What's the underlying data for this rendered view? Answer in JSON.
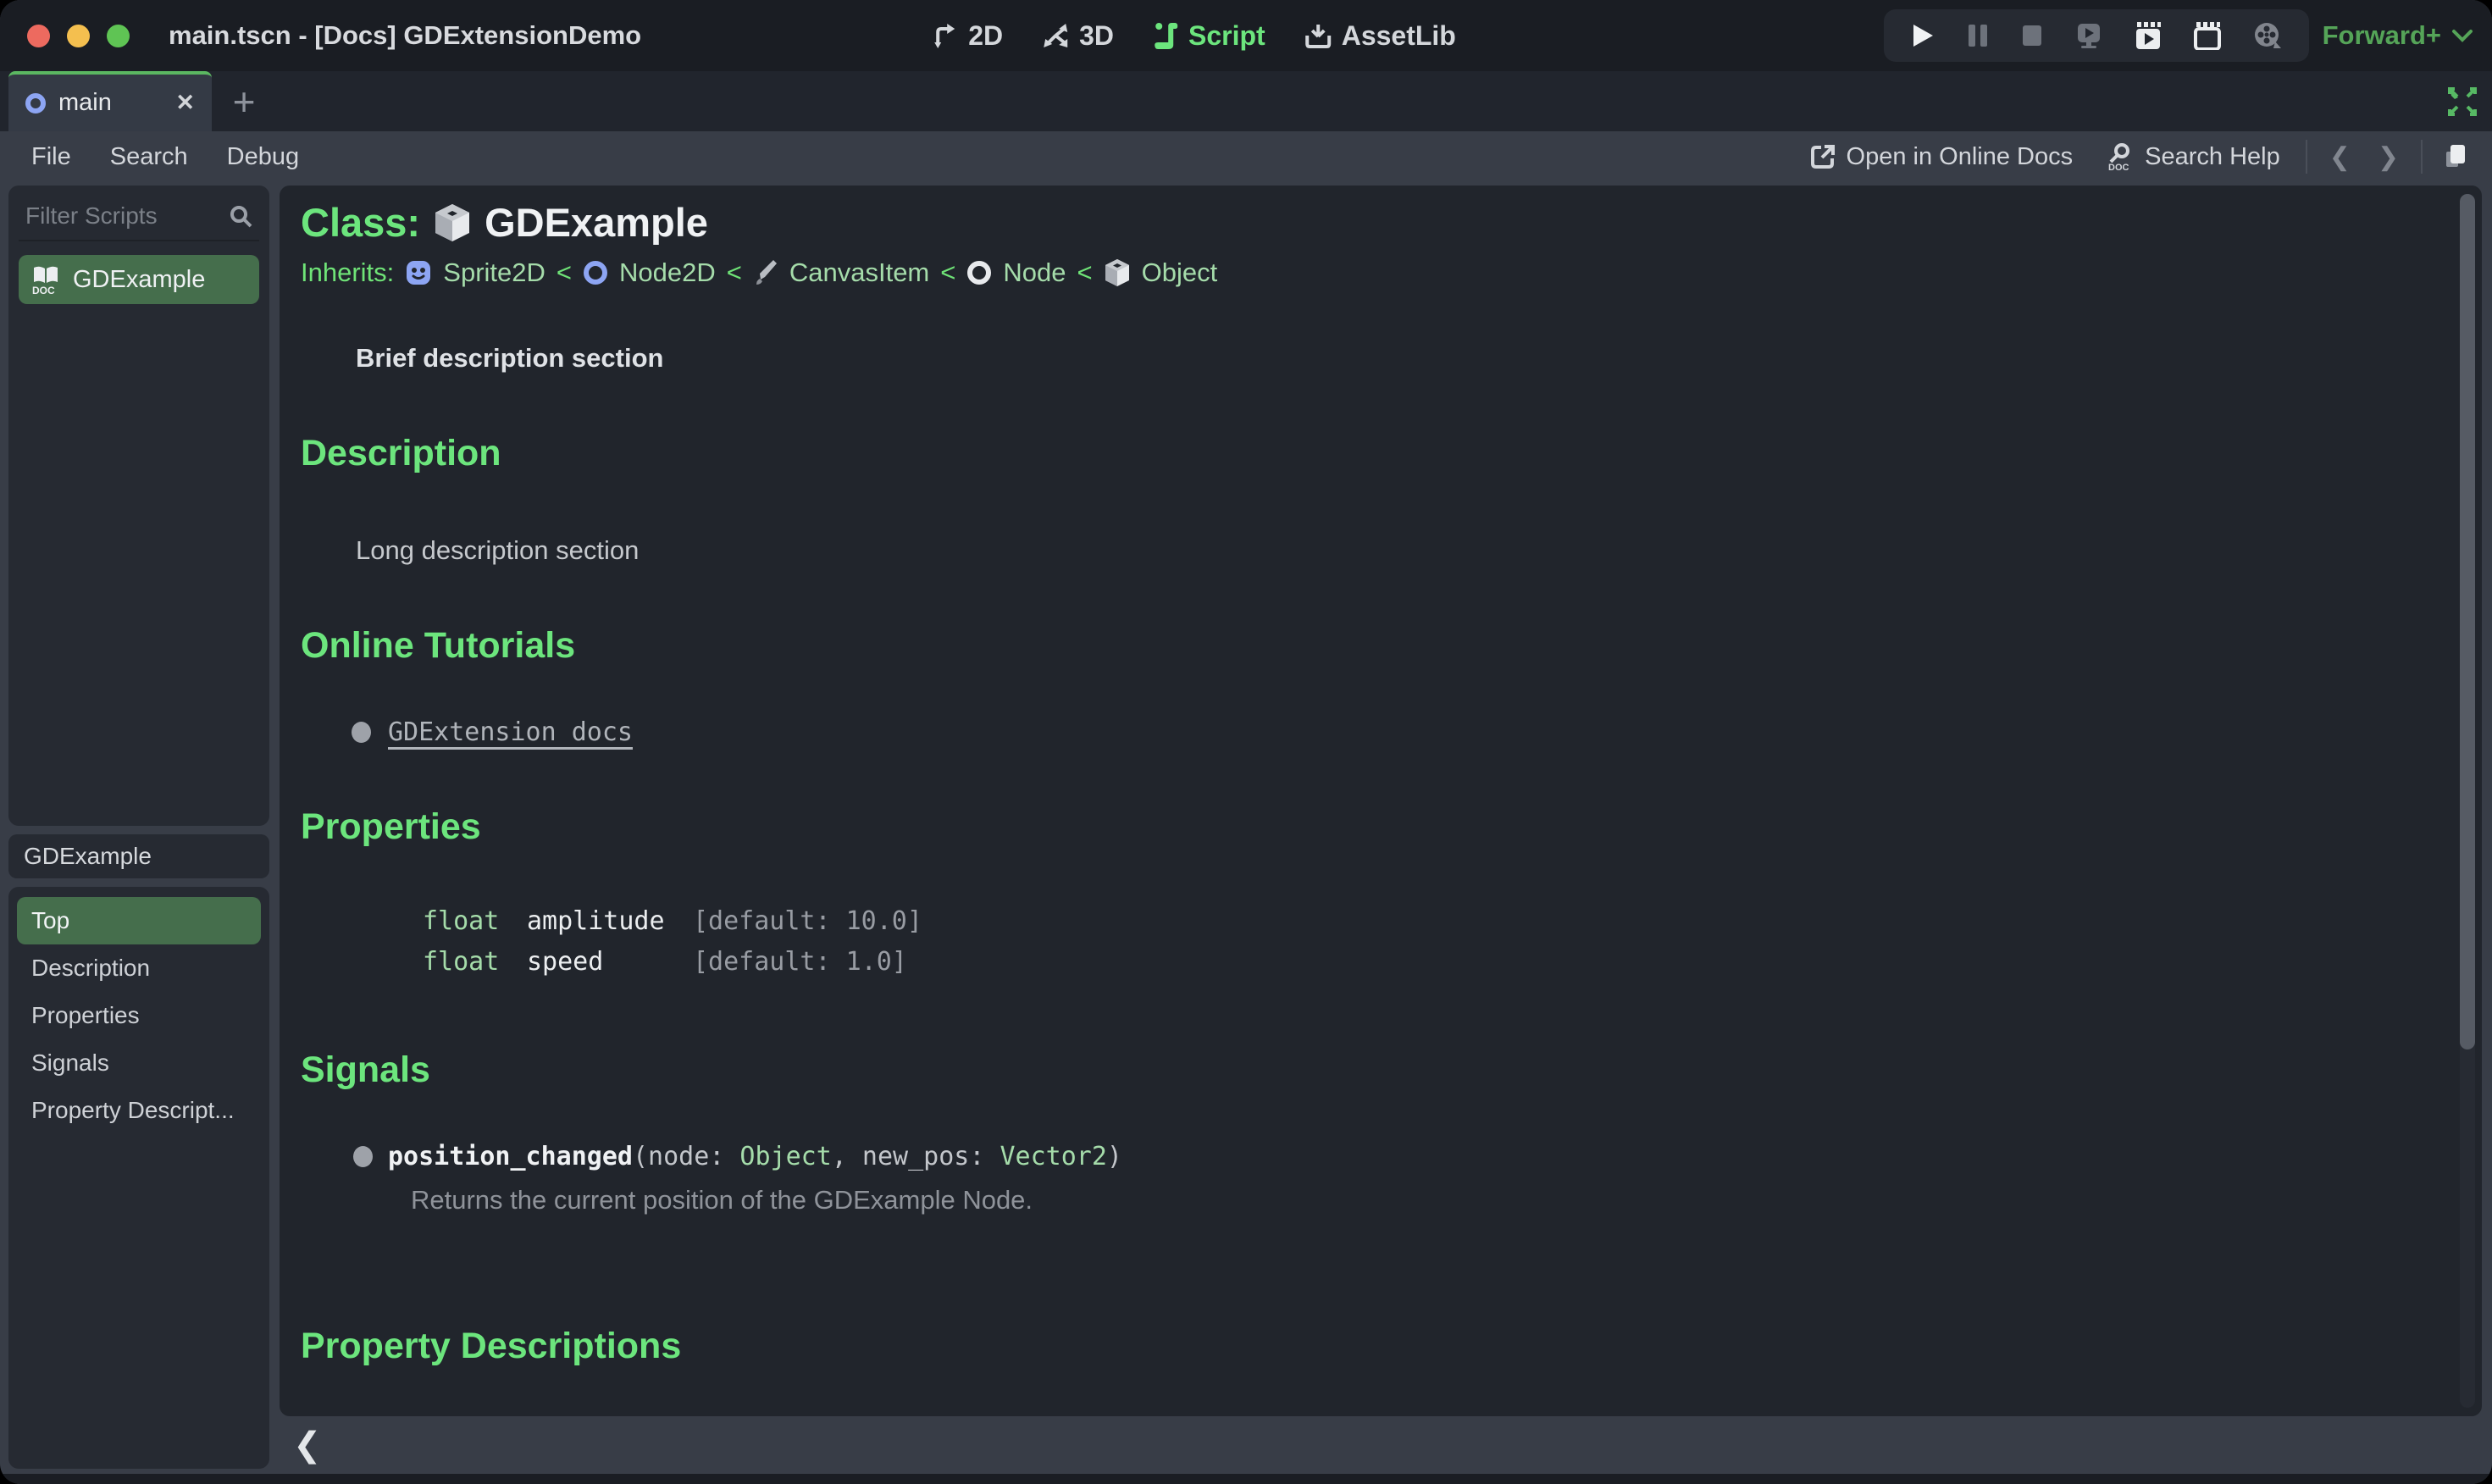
{
  "titlebar": {
    "title": "main.tscn - [Docs] GDExtensionDemo",
    "workspaces": [
      {
        "label": "2D"
      },
      {
        "label": "3D"
      },
      {
        "label": "Script"
      },
      {
        "label": "AssetLib"
      }
    ],
    "renderer": "Forward+"
  },
  "tabs": {
    "active_label": "main",
    "close_glyph": "✕",
    "plus_glyph": "+"
  },
  "menubar": {
    "items": [
      {
        "label": "File"
      },
      {
        "label": "Search"
      },
      {
        "label": "Debug"
      }
    ],
    "online_docs_label": "Open in Online Docs",
    "search_help_label": "Search Help",
    "nav_back_glyph": "❮",
    "nav_forward_glyph": "❯"
  },
  "scripts_panel": {
    "filter_placeholder": "Filter Scripts",
    "items": [
      {
        "label": "GDExample",
        "selected": true
      }
    ]
  },
  "outline_panel": {
    "title": "GDExample",
    "items": [
      {
        "label": "Top",
        "selected": true
      },
      {
        "label": "Description"
      },
      {
        "label": "Properties"
      },
      {
        "label": "Signals"
      },
      {
        "label": "Property Descript..."
      }
    ]
  },
  "doc": {
    "class_label": "Class:",
    "class_name": "GDExample",
    "inherits_label": "Inherits:",
    "inherits_sep": "<",
    "inherits_chain": [
      {
        "name": "Sprite2D",
        "icon": "sprite2d-icon"
      },
      {
        "name": "Node2D",
        "icon": "node2d-icon"
      },
      {
        "name": "CanvasItem",
        "icon": "canvasitem-icon"
      },
      {
        "name": "Node",
        "icon": "node-icon"
      },
      {
        "name": "Object",
        "icon": "object-icon"
      }
    ],
    "brief": "Brief description section",
    "sections": {
      "description": {
        "heading": "Description",
        "body": "Long description section"
      },
      "tutorials": {
        "heading": "Online Tutorials",
        "links": [
          {
            "label": "GDExtension docs"
          }
        ]
      },
      "properties": {
        "heading": "Properties",
        "rows": [
          {
            "type": "float",
            "name": "amplitude",
            "default": "[default: 10.0]"
          },
          {
            "type": "float",
            "name": "speed",
            "default": "[default: 1.0]"
          }
        ]
      },
      "signals": {
        "heading": "Signals",
        "items": [
          {
            "name": "position_changed",
            "params_pre": "(node: ",
            "type1": "Object",
            "params_mid": ", new_pos: ",
            "type2": "Vector2",
            "params_post": ")",
            "description": "Returns the current position of the GDExample Node."
          }
        ]
      },
      "property_descriptions": {
        "heading": "Property Descriptions"
      }
    },
    "collapse_glyph": "❮"
  },
  "colors": {
    "accent_green": "#6ce57d",
    "selection_green": "#456e4c",
    "renderer_green": "#55a458",
    "link_green": "#a5dcaa"
  }
}
